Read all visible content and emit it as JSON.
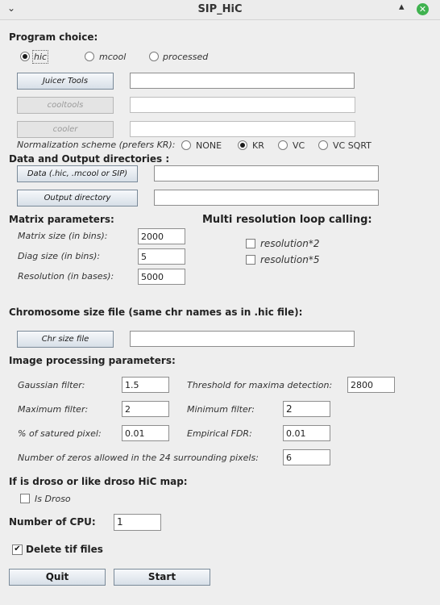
{
  "window": {
    "title": "SIP_HiC",
    "menu_glyph": "⌄",
    "minimize_glyph": "▴",
    "close_glyph": "✕"
  },
  "program": {
    "heading": "Program choice:",
    "options": [
      {
        "label": "hic",
        "selected": true
      },
      {
        "label": "mcool",
        "selected": false
      },
      {
        "label": "processed",
        "selected": false
      }
    ]
  },
  "tools": {
    "juicer_label": "Juicer Tools",
    "juicer_path": "",
    "cooltools_label": "cooltools",
    "cooltools_path": "",
    "cooler_label": "cooler",
    "cooler_path": ""
  },
  "normalization": {
    "label": "Normalization scheme (prefers KR):",
    "options": [
      {
        "label": "NONE",
        "selected": false
      },
      {
        "label": "KR",
        "selected": true
      },
      {
        "label": "VC",
        "selected": false
      },
      {
        "label": "VC SQRT",
        "selected": false
      }
    ]
  },
  "directories": {
    "heading": "Data and Output directories :",
    "data_label": "Data (.hic, .mcool or SIP)",
    "data_path": "",
    "output_label": "Output directory",
    "output_path": ""
  },
  "matrix": {
    "heading": "Matrix parameters:",
    "matrix_size_label": "Matrix size (in bins):",
    "matrix_size": "2000",
    "diag_size_label": "Diag size (in bins):",
    "diag_size": "5",
    "resolution_label": "Resolution (in bases):",
    "resolution": "5000"
  },
  "multires": {
    "heading": "Multi resolution loop calling:",
    "res2_label": "resolution*2",
    "res2_checked": false,
    "res5_label": "resolution*5",
    "res5_checked": false
  },
  "chromosome": {
    "heading": "Chromosome size file (same chr names as in .hic file):",
    "button_label": "Chr size file",
    "path": ""
  },
  "image": {
    "heading": "Image processing parameters:",
    "gaussian_label": "Gaussian filter:",
    "gaussian": "1.5",
    "threshold_label": "Threshold for maxima detection:",
    "threshold": "2800",
    "max_filter_label": "Maximum filter:",
    "max_filter": "2",
    "min_filter_label": "Minimum filter:",
    "min_filter": "2",
    "saturated_label": "% of satured pixel:",
    "saturated": "0.01",
    "fdr_label": "Empirical FDR:",
    "fdr": "0.01",
    "zeros_label": "Number of zeros allowed in the 24 surrounding pixels:",
    "zeros": "6"
  },
  "droso": {
    "heading": "If is droso or like droso HiC map:",
    "label": "Is Droso",
    "checked": false
  },
  "cpu": {
    "label": "Number of CPU:",
    "value": "1"
  },
  "delete_tif": {
    "label": "Delete tif files",
    "checked": true,
    "check_glyph": "✔"
  },
  "actions": {
    "quit_label": "Quit",
    "start_label": "Start"
  }
}
